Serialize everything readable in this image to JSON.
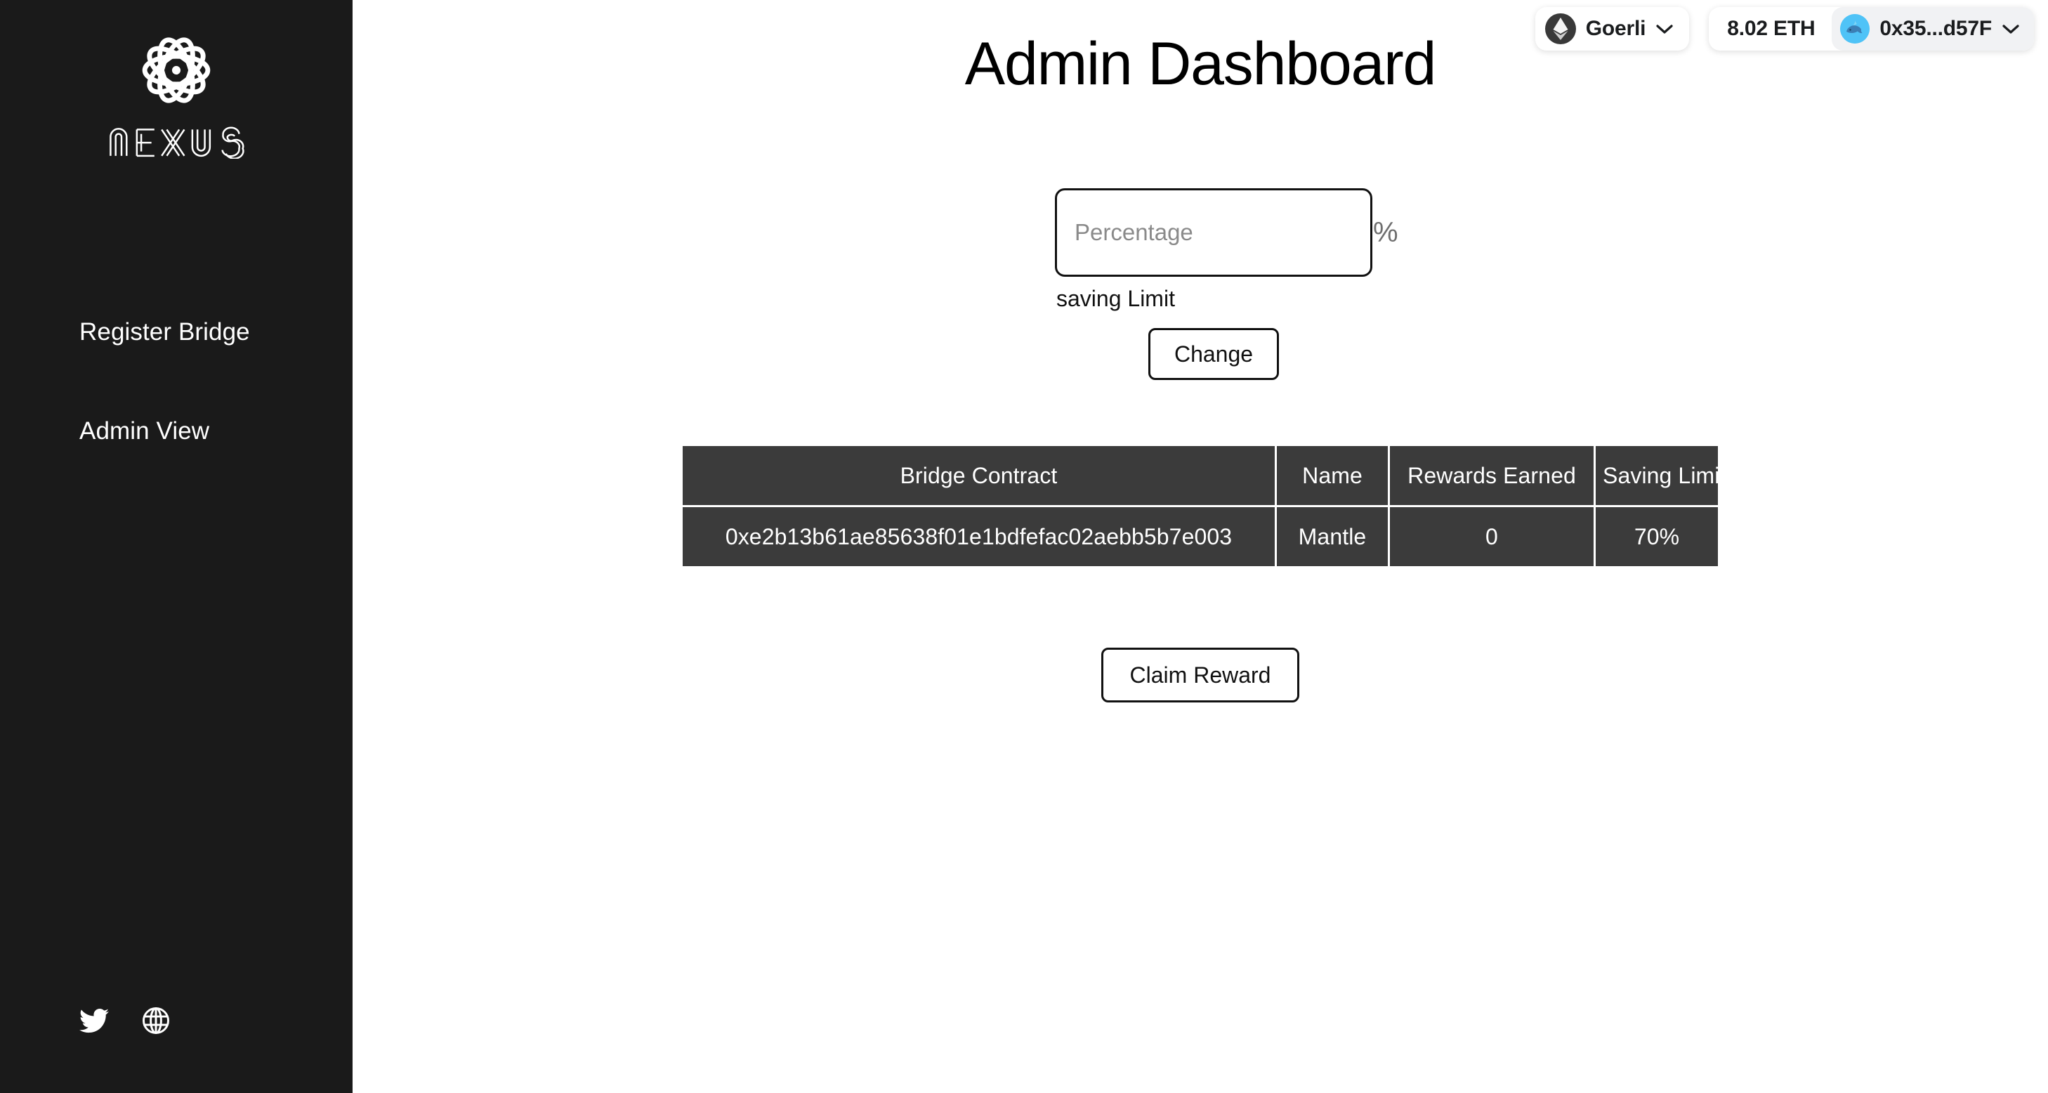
{
  "sidebar": {
    "brand": {
      "logo_icon": "nexus-atom-logo",
      "wordmark": "NEXUS"
    },
    "items": [
      {
        "label": "Register Bridge",
        "icon": "none"
      },
      {
        "label": "Admin View",
        "icon": "none"
      }
    ],
    "socials": [
      {
        "icon": "twitter-icon",
        "label": "Twitter"
      },
      {
        "icon": "globe-icon",
        "label": "Website"
      }
    ],
    "background_color": "#1a1a1a"
  },
  "header": {
    "title": "Admin Dashboard",
    "wallet": {
      "network": "Goerli",
      "network_icon": "ethereum-icon",
      "network_chevron_icon": "chevron-down-icon",
      "balance": "8.02 ETH",
      "address": "0x35...d57F",
      "avatar_icon": "whale-avatar-icon",
      "avatar_color": "#4fc3f7",
      "address_chevron_icon": "chevron-down-icon"
    }
  },
  "form": {
    "percentage_placeholder": "Percentage",
    "percentage_value": "",
    "percent_symbol": "%",
    "label": "saving Limit",
    "change_button": "Change"
  },
  "table": {
    "columns": [
      "Bridge Contract",
      "Name",
      "Rewards Earned",
      "Saving Limit"
    ],
    "rows": [
      {
        "contract": "0xe2b13b61ae85638f01e1bdfefac02aebb5b7e003",
        "name": "Mantle",
        "rewards_earned": "0",
        "saving_limit": "70%"
      }
    ],
    "header_bg": "#3b3b3b",
    "row_bg": "#3b3b3b"
  },
  "actions": {
    "claim_button": "Claim Reward"
  }
}
